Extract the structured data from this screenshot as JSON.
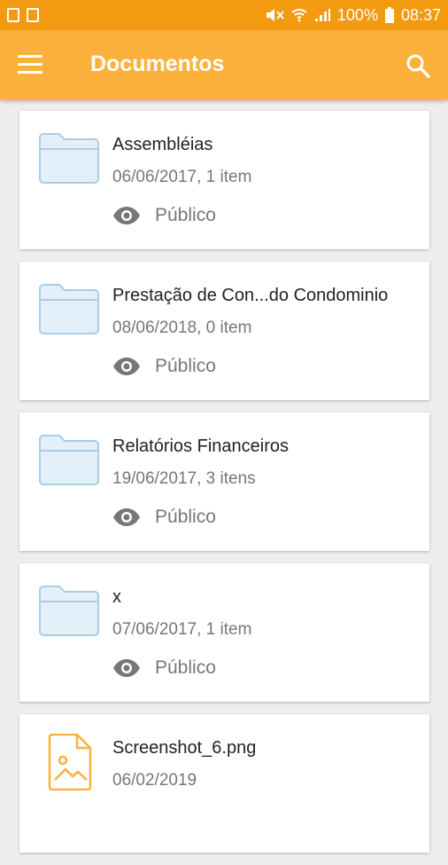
{
  "statusbar": {
    "battery_percent": "100%",
    "time": "08:37"
  },
  "appbar": {
    "title": "Documentos",
    "menu_icon": "menu-icon",
    "search_icon": "search-icon"
  },
  "colors": {
    "statusbar": "#f29b11",
    "appbar": "#fbb13c",
    "folder_fill": "#e3f0fa",
    "folder_stroke": "#a9cde8",
    "file_stroke": "#f6b23a"
  },
  "items": [
    {
      "name": "Assembléias",
      "meta": "06/06/2017, 1 item",
      "visibility": "Público",
      "type": "folder"
    },
    {
      "name": "Prestação de Con...do Condominio",
      "meta": "08/06/2018, 0 item",
      "visibility": "Público",
      "type": "folder"
    },
    {
      "name": "Relatórios Financeiros",
      "meta": "19/06/2017, 3 itens",
      "visibility": "Público",
      "type": "folder"
    },
    {
      "name": "x",
      "meta": "07/06/2017, 1 item",
      "visibility": "Público",
      "type": "folder"
    },
    {
      "name": "Screenshot_6.png",
      "meta": "06/02/2019",
      "type": "image-file"
    }
  ]
}
